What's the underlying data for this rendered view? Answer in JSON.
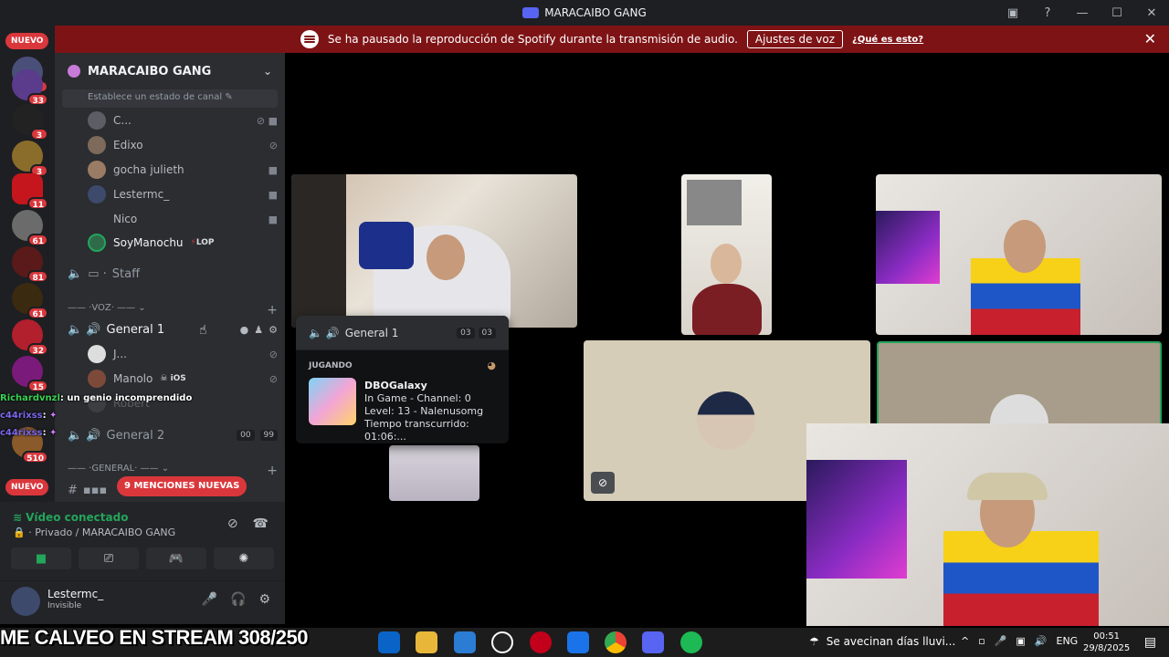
{
  "window": {
    "title": "MARACAIBO GANG"
  },
  "notice": {
    "message": "Se ha pausado la reproducción de Spotify durante la transmisión de audio.",
    "button_label": "Ajustes de voz",
    "link_label": "¿Qué es esto?"
  },
  "rail": {
    "badges": [
      "1",
      "33",
      "3",
      "3",
      "11",
      "61",
      "81",
      "61",
      "32",
      "15",
      "510"
    ],
    "new_label": "NUEVO"
  },
  "server": {
    "name": "MARACAIBO GANG",
    "channel_status_placeholder": "Establece un estado de canal"
  },
  "members_top": [
    {
      "name": "C..."
    },
    {
      "name": "Edixo"
    },
    {
      "name": "gocha julieth"
    },
    {
      "name": "Lestermc_"
    },
    {
      "name": "Nico"
    },
    {
      "name": "SoyManochu",
      "tag": "LOP"
    }
  ],
  "channels": {
    "staff": "Staff",
    "voice_category": "VOZ",
    "general1": "General 1",
    "general1_members": [
      {
        "name": "J..."
      },
      {
        "name": "Manolo",
        "tag": "iOS"
      },
      {
        "name": "Robert"
      }
    ],
    "general2": "General 2",
    "general2_counts": [
      "00",
      "99"
    ],
    "general_category": "GENERAL",
    "mentions_label": "9 MENCIONES NUEVAS"
  },
  "chat": [
    {
      "user": "Richardvnzl",
      "text": ": un genio incomprendido"
    },
    {
      "user": "c44rixss",
      "text": ":"
    },
    {
      "user": "c44rixss",
      "text": ":"
    }
  ],
  "voice": {
    "status": "Vídeo conectado",
    "location": "Privado / MARACAIBO GANG"
  },
  "user": {
    "name": "Lestermc_",
    "status": "Invisible"
  },
  "popup": {
    "channel": "General 1",
    "counts": [
      "03",
      "03"
    ],
    "section": "JUGANDO",
    "game": "DBOGalaxy",
    "lines": [
      "In Game - Channel: 0",
      "Level: 13 - Nalenusomg",
      "Tiempo transcurrido: 01:06:..."
    ]
  },
  "caption": "ME CALVEO EN STREAM 308/250",
  "taskbar": {
    "weather": "Se avecinan días lluvi...",
    "lang": "ENG",
    "time": "00:51",
    "date": "29/8/2025"
  },
  "colors": {
    "accent_green": "#23a55a",
    "danger": "#da373c",
    "notice_bg": "#7e1316"
  }
}
